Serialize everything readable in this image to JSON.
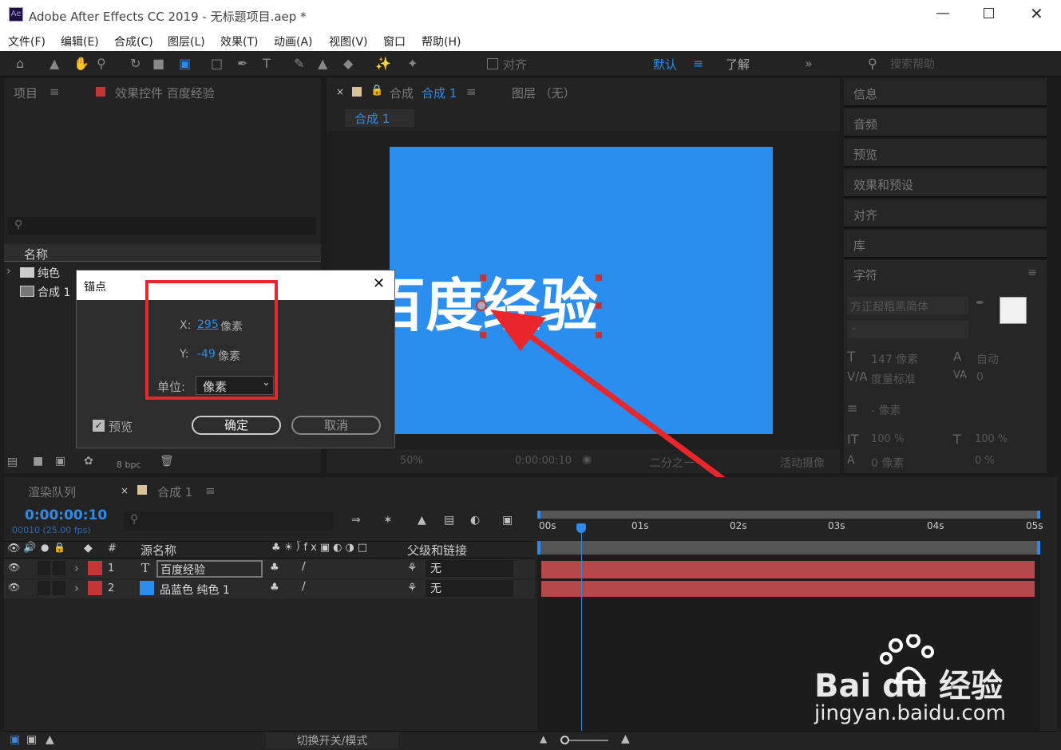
{
  "window": {
    "app_icon": "Ae",
    "title": "Adobe After Effects CC 2019 - 无标题项目.aep *"
  },
  "menu": [
    "文件(F)",
    "编辑(E)",
    "合成(C)",
    "图层(L)",
    "效果(T)",
    "动画(A)",
    "视图(V)",
    "窗口",
    "帮助(H)"
  ],
  "toolbar": {
    "snap_label": "对齐",
    "workspace_default": "默认",
    "workspace_learn": "了解",
    "search_placeholder": "搜索帮助"
  },
  "project_panel": {
    "tab_project": "项目",
    "tab_effects": "效果控件 百度经验",
    "col_name": "名称",
    "items": [
      {
        "name": "纯色"
      },
      {
        "name": "合成 1"
      }
    ],
    "bpc": "8 bpc"
  },
  "comp_panel": {
    "tab_comp_prefix": "合成",
    "tab_comp_name": "合成 1",
    "tab_layer": "图层 （无）",
    "sub_tab": "合成 1",
    "canvas_text": "百度经验",
    "canvas_color": "#2b8ded",
    "zoom": "50%",
    "timecode": "0:00:00:10",
    "resolution": "二分之一",
    "camera": "活动摄像"
  },
  "right_panels": [
    "信息",
    "音频",
    "预览",
    "效果和预设",
    "对齐",
    "库",
    "字符"
  ],
  "character": {
    "font": "方正超粗黑简体",
    "size": "147 像素",
    "leading": "自动",
    "kerning": "度量标准",
    "tracking": "0",
    "stroke": "- 像素",
    "vscale": "100 %",
    "hscale": "100 %",
    "baseline": "0 像素",
    "tsume": "0 %"
  },
  "dialog": {
    "title": "锚点",
    "x_label": "X:",
    "x_value": "295",
    "y_label": "Y:",
    "y_value": "-49",
    "unit_suffix": "像素",
    "unit_label": "单位:",
    "unit_value": "像素",
    "preview_label": "预览",
    "ok": "确定",
    "cancel": "取消"
  },
  "timeline": {
    "tab_render": "渲染队列",
    "tab_comp": "合成 1",
    "timecode": "0:00:00:10",
    "frame_info": "00010 (25.00 fps)",
    "col_num": "#",
    "col_source": "源名称",
    "col_parent": "父级和链接",
    "layers": [
      {
        "num": "1",
        "type": "T",
        "name": "百度经验",
        "parent": "无",
        "color": "#c33535"
      },
      {
        "num": "2",
        "type": "",
        "name": "品蓝色 纯色 1",
        "parent": "无",
        "color": "#c33535"
      }
    ],
    "ruler": [
      "00s",
      "01s",
      "02s",
      "03s",
      "04s",
      "05s"
    ],
    "footer": "切换开关/模式"
  },
  "watermark": {
    "brand": "Bai du 经验",
    "url": "jingyan.baidu.com"
  },
  "colors": {
    "accent": "#2d8ceb",
    "highlight_box": "#e8262b",
    "layer_bar": "#b54848"
  }
}
